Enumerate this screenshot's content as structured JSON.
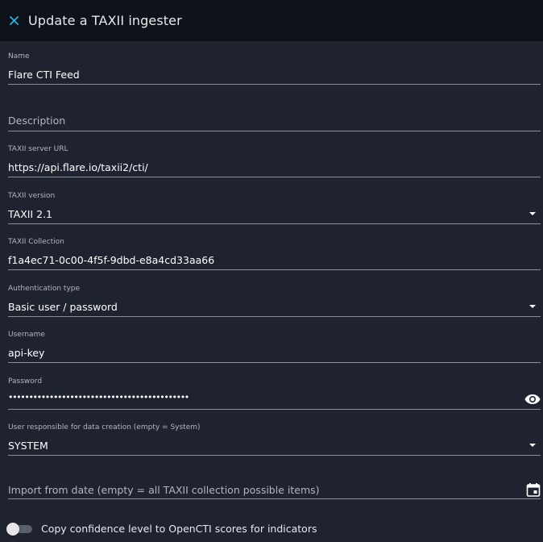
{
  "header": {
    "title": "Update a TAXII ingester",
    "close_icon": "close-icon"
  },
  "form": {
    "name": {
      "label": "Name",
      "value": "Flare CTI Feed"
    },
    "description": {
      "placeholder": "Description"
    },
    "server_url": {
      "label": "TAXII server URL",
      "value": "https://api.flare.io/taxii2/cti/"
    },
    "version": {
      "label": "TAXII version",
      "value": "TAXII 2.1"
    },
    "collection": {
      "label": "TAXII Collection",
      "value": "f1a4ec71-0c00-4f5f-9dbd-e8a4cd33aa66"
    },
    "auth_type": {
      "label": "Authentication type",
      "value": "Basic user / password"
    },
    "username": {
      "label": "Username",
      "value": "api-key"
    },
    "password": {
      "label": "Password",
      "value": "••••••••••••••••••••••••••••••••••••••••••••",
      "icon": "eye-icon"
    },
    "user_responsible": {
      "label": "User responsible for data creation (empty = System)",
      "value": "SYSTEM"
    },
    "import_date": {
      "placeholder": "Import from date (empty = all TAXII collection possible items)",
      "icon": "calendar-icon"
    },
    "confidence_toggle": {
      "label": "Copy confidence level to OpenCTI scores for indicators",
      "checked": false
    }
  },
  "colors": {
    "background": "#1f2330",
    "header_background": "#0d1118",
    "accent": "#1ab4e8",
    "text": "#ffffff",
    "muted_text": "#b3b6bf",
    "underline": "#8b8f99"
  }
}
